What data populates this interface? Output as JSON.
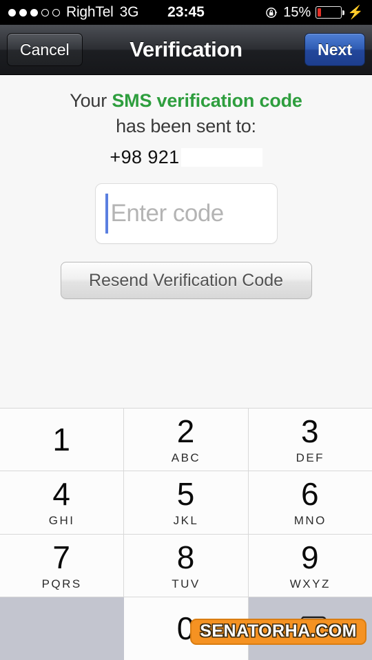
{
  "status_bar": {
    "signal_dots_filled": 3,
    "signal_dots_total": 5,
    "carrier": "RighTel",
    "network": "3G",
    "time": "23:45",
    "battery_percent": "15%",
    "battery_level": 15,
    "rotation_lock_icon": "rotation-lock-icon",
    "charging_icon": "lightning-bolt-icon"
  },
  "nav_bar": {
    "cancel_label": "Cancel",
    "title": "Verification",
    "next_label": "Next"
  },
  "content": {
    "message_prefix": "Your ",
    "message_highlight": "SMS verification code",
    "message_line2": "has been sent to:",
    "phone_number": "+98 921",
    "code_input": {
      "value": "",
      "placeholder": "Enter code"
    },
    "resend_label": "Resend Verification Code"
  },
  "keypad": {
    "rows": [
      [
        {
          "digit": "1",
          "letters": ""
        },
        {
          "digit": "2",
          "letters": "ABC"
        },
        {
          "digit": "3",
          "letters": "DEF"
        }
      ],
      [
        {
          "digit": "4",
          "letters": "GHI"
        },
        {
          "digit": "5",
          "letters": "JKL"
        },
        {
          "digit": "6",
          "letters": "MNO"
        }
      ],
      [
        {
          "digit": "7",
          "letters": "PQRS"
        },
        {
          "digit": "8",
          "letters": "TUV"
        },
        {
          "digit": "9",
          "letters": "WXYZ"
        }
      ],
      [
        {
          "digit": "",
          "letters": ""
        },
        {
          "digit": "0",
          "letters": ""
        },
        {
          "digit": "",
          "letters": "",
          "icon": "backspace-icon"
        }
      ]
    ]
  },
  "watermark": {
    "text": "SENATORHA.COM"
  },
  "colors": {
    "accent_green": "#2e9e3e",
    "next_button_blue": "#2f5cb4",
    "cursor_blue": "#5b7fe0",
    "battery_red": "#e53027",
    "watermark_orange": "#f59222",
    "keypad_gray": "#c3c5cf"
  }
}
